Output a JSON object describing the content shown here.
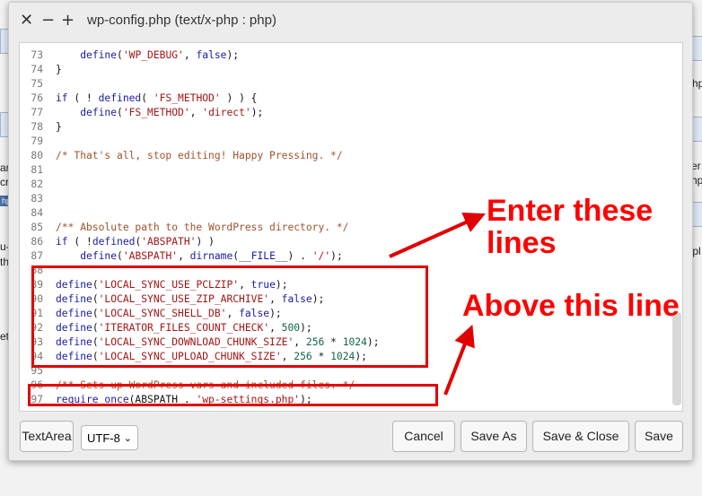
{
  "window": {
    "title": "wp-config.php (text/x-php : php)",
    "close_glyph": "✕",
    "minimize_glyph": "−",
    "maximize_glyph": "+"
  },
  "editor": {
    "lines": [
      {
        "n": "73",
        "parts": [
          [
            "pl",
            "    "
          ],
          [
            "kw",
            "define"
          ],
          [
            "pl",
            "("
          ],
          [
            "str",
            "'WP_DEBUG'"
          ],
          [
            "pl",
            ", "
          ],
          [
            "kw",
            "false"
          ],
          [
            "pl",
            ");"
          ]
        ]
      },
      {
        "n": "74",
        "parts": [
          [
            "pl",
            "}"
          ]
        ]
      },
      {
        "n": "75",
        "parts": []
      },
      {
        "n": "76",
        "parts": [
          [
            "kw",
            "if"
          ],
          [
            "pl",
            " ( ! "
          ],
          [
            "kw",
            "defined"
          ],
          [
            "pl",
            "( "
          ],
          [
            "str",
            "'FS_METHOD'"
          ],
          [
            "pl",
            " ) ) {"
          ]
        ]
      },
      {
        "n": "77",
        "parts": [
          [
            "pl",
            "    "
          ],
          [
            "kw",
            "define"
          ],
          [
            "pl",
            "("
          ],
          [
            "str",
            "'FS_METHOD'"
          ],
          [
            "pl",
            ", "
          ],
          [
            "str",
            "'direct'"
          ],
          [
            "pl",
            ");"
          ]
        ]
      },
      {
        "n": "78",
        "parts": [
          [
            "pl",
            "}"
          ]
        ]
      },
      {
        "n": "79",
        "parts": []
      },
      {
        "n": "80",
        "parts": [
          [
            "cm",
            "/* That's all, stop editing! Happy Pressing. */"
          ]
        ]
      },
      {
        "n": "81",
        "parts": []
      },
      {
        "n": "82",
        "parts": []
      },
      {
        "n": "83",
        "parts": []
      },
      {
        "n": "84",
        "parts": []
      },
      {
        "n": "85",
        "parts": [
          [
            "cm",
            "/** Absolute path to the WordPress directory. */"
          ]
        ]
      },
      {
        "n": "86",
        "parts": [
          [
            "kw",
            "if"
          ],
          [
            "pl",
            " ( !"
          ],
          [
            "kw",
            "defined"
          ],
          [
            "pl",
            "("
          ],
          [
            "str",
            "'ABSPATH'"
          ],
          [
            "pl",
            ") )"
          ]
        ]
      },
      {
        "n": "87",
        "parts": [
          [
            "pl",
            "    "
          ],
          [
            "kw",
            "define"
          ],
          [
            "pl",
            "("
          ],
          [
            "str",
            "'ABSPATH'"
          ],
          [
            "pl",
            ", "
          ],
          [
            "kw",
            "dirname"
          ],
          [
            "pl",
            "("
          ],
          [
            "kw",
            "__FILE__"
          ],
          [
            "pl",
            ") . "
          ],
          [
            "str",
            "'/'"
          ],
          [
            "pl",
            ");"
          ]
        ]
      },
      {
        "n": "88",
        "parts": []
      },
      {
        "n": "89",
        "parts": [
          [
            "kw",
            "define"
          ],
          [
            "pl",
            "("
          ],
          [
            "str",
            "'LOCAL_SYNC_USE_PCLZIP'"
          ],
          [
            "pl",
            ", "
          ],
          [
            "kw",
            "true"
          ],
          [
            "pl",
            ");"
          ]
        ]
      },
      {
        "n": "90",
        "parts": [
          [
            "kw",
            "define"
          ],
          [
            "pl",
            "("
          ],
          [
            "str",
            "'LOCAL_SYNC_USE_ZIP_ARCHIVE'"
          ],
          [
            "pl",
            ", "
          ],
          [
            "kw",
            "false"
          ],
          [
            "pl",
            ");"
          ]
        ]
      },
      {
        "n": "91",
        "parts": [
          [
            "kw",
            "define"
          ],
          [
            "pl",
            "("
          ],
          [
            "str",
            "'LOCAL_SYNC_SHELL_DB'"
          ],
          [
            "pl",
            ", "
          ],
          [
            "kw",
            "false"
          ],
          [
            "pl",
            ");"
          ]
        ]
      },
      {
        "n": "92",
        "parts": [
          [
            "kw",
            "define"
          ],
          [
            "pl",
            "("
          ],
          [
            "str",
            "'ITERATOR_FILES_COUNT_CHECK'"
          ],
          [
            "pl",
            ", "
          ],
          [
            "num",
            "500"
          ],
          [
            "pl",
            ");"
          ]
        ]
      },
      {
        "n": "93",
        "parts": [
          [
            "kw",
            "define"
          ],
          [
            "pl",
            "("
          ],
          [
            "str",
            "'LOCAL_SYNC_DOWNLOAD_CHUNK_SIZE'"
          ],
          [
            "pl",
            ", "
          ],
          [
            "num",
            "256"
          ],
          [
            "pl",
            " * "
          ],
          [
            "num",
            "1024"
          ],
          [
            "pl",
            ");"
          ]
        ]
      },
      {
        "n": "94",
        "parts": [
          [
            "kw",
            "define"
          ],
          [
            "pl",
            "("
          ],
          [
            "str",
            "'LOCAL_SYNC_UPLOAD_CHUNK_SIZE'"
          ],
          [
            "pl",
            ", "
          ],
          [
            "num",
            "256"
          ],
          [
            "pl",
            " * "
          ],
          [
            "num",
            "1024"
          ],
          [
            "pl",
            ");"
          ]
        ]
      },
      {
        "n": "95",
        "parts": []
      },
      {
        "n": "96",
        "parts": [
          [
            "cm",
            "/** Sets up WordPress vars and included files. */"
          ]
        ]
      },
      {
        "n": "97",
        "parts": [
          [
            "kw",
            "require_once"
          ],
          [
            "pl",
            "(ABSPATH . "
          ],
          [
            "str",
            "'wp-settings.php'"
          ],
          [
            "pl",
            ");"
          ]
        ]
      }
    ]
  },
  "footer": {
    "textarea_label": "TextArea",
    "encoding_value": "UTF-8",
    "cancel_label": "Cancel",
    "save_as_label": "Save As",
    "save_close_label": "Save & Close",
    "save_label": "Save"
  },
  "annotations": {
    "enter_text": "Enter these lines",
    "enter_text_line1": "Enter these",
    "enter_text_line2": "lines",
    "above_text": "Above this line",
    "color": "#ff0000"
  },
  "background": {
    "fragments": [
      "hp",
      "er",
      "hp",
      ".pl",
      "an",
      "cr",
      "hp",
      "u-c",
      "th",
      "et"
    ]
  }
}
